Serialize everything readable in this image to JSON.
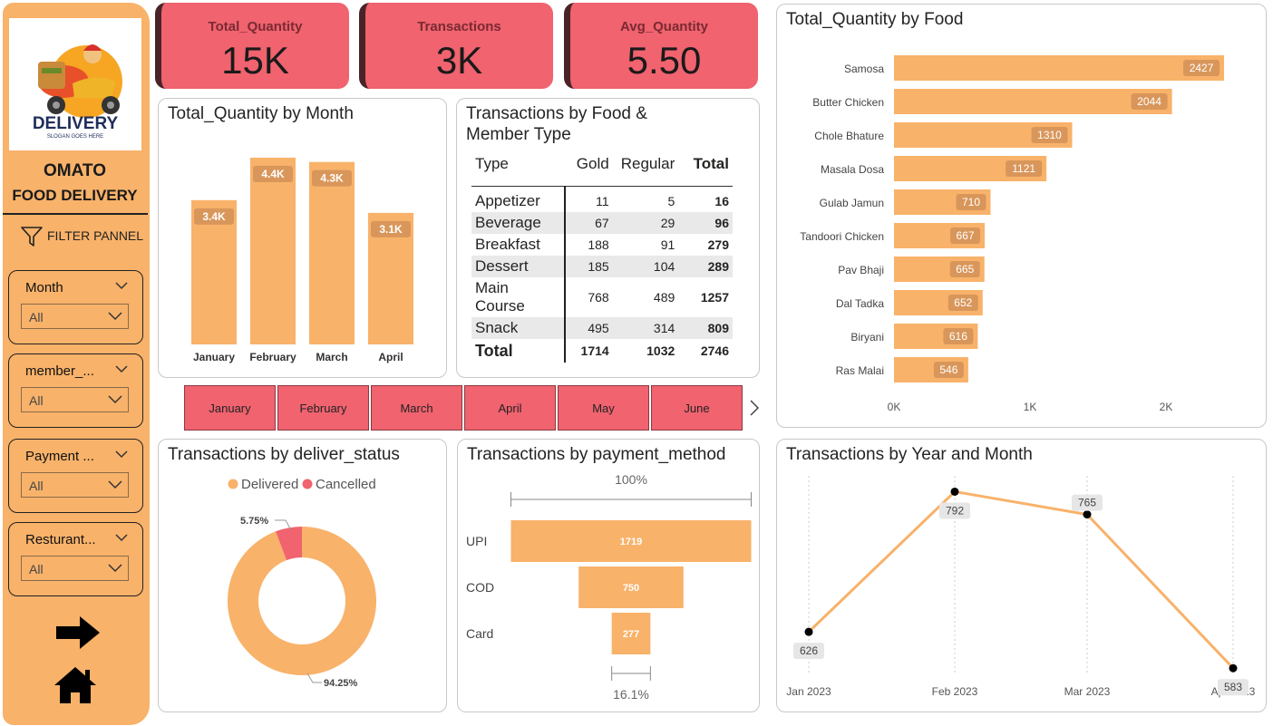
{
  "sidebar": {
    "logo_text": "DELIVERY",
    "logo_slogan": "SLOGAN GOES HERE",
    "brand_line1": "OMATO",
    "brand_line2": "FOOD DELIVERY",
    "filter_title": "FILTER PANNEL",
    "slicers": [
      {
        "label": "Month",
        "value": "All"
      },
      {
        "label": "member_...",
        "value": "All"
      },
      {
        "label": "Payment ...",
        "value": "All"
      },
      {
        "label": "Resturant...",
        "value": "All"
      }
    ]
  },
  "kpis": [
    {
      "title": "Total_Quantity",
      "value": "15K"
    },
    {
      "title": "Transactions",
      "value": "3K"
    },
    {
      "title": "Avg_Quantity",
      "value": "5.50"
    }
  ],
  "month_chart": {
    "title": "Total_Quantity by Month",
    "chart_data": {
      "type": "bar",
      "categories": [
        "January",
        "February",
        "March",
        "April"
      ],
      "values": [
        3400,
        4400,
        4300,
        3100
      ],
      "labels": [
        "3.4K",
        "4.4K",
        "4.3K",
        "3.1K"
      ]
    }
  },
  "matrix": {
    "title_line1": "Transactions by Food &",
    "title_line2": "Member Type",
    "headers": [
      "Type",
      "Gold",
      "Regular",
      "Total"
    ],
    "rows": [
      [
        "Appetizer",
        "11",
        "5",
        "16"
      ],
      [
        "Beverage",
        "67",
        "29",
        "96"
      ],
      [
        "Breakfast",
        "188",
        "91",
        "279"
      ],
      [
        "Dessert",
        "185",
        "104",
        "289"
      ],
      [
        "Main Course",
        "768",
        "489",
        "1257"
      ],
      [
        "Snack",
        "495",
        "314",
        "809"
      ]
    ],
    "total_row": [
      "Total",
      "1714",
      "1032",
      "2746"
    ]
  },
  "month_slicer": {
    "months": [
      "January",
      "February",
      "March",
      "April",
      "May",
      "June"
    ]
  },
  "food_chart": {
    "title": "Total_Quantity by Food",
    "chart_data": {
      "type": "bar",
      "categories": [
        "Samosa",
        "Butter Chicken",
        "Chole Bhature",
        "Masala Dosa",
        "Gulab Jamun",
        "Tandoori Chicken",
        "Pav Bhaji",
        "Dal Tadka",
        "Biryani",
        "Ras Malai"
      ],
      "values": [
        2427,
        2044,
        1310,
        1121,
        710,
        667,
        665,
        652,
        616,
        546
      ],
      "x_ticks": [
        "0K",
        "1K",
        "2K"
      ],
      "xlim": [
        0,
        2700
      ]
    }
  },
  "donut": {
    "title": "Transactions by deliver_status",
    "chart_data": {
      "type": "pie",
      "labels": [
        "Delivered",
        "Cancelled"
      ],
      "values": [
        94.25,
        5.75
      ],
      "value_labels": [
        "94.25%",
        "5.75%"
      ]
    }
  },
  "funnel": {
    "title": "Transactions by payment_method",
    "top_pct": "100%",
    "bottom_pct": "16.1%",
    "chart_data": {
      "type": "bar",
      "categories": [
        "UPI",
        "COD",
        "Card"
      ],
      "values": [
        1719,
        750,
        277
      ]
    }
  },
  "line": {
    "title": "Transactions by Year and Month",
    "chart_data": {
      "type": "line",
      "x": [
        "Jan 2023",
        "Feb 2023",
        "Mar 2023",
        "Apr 2023"
      ],
      "values": [
        626,
        792,
        765,
        583
      ],
      "ylim": [
        580,
        800
      ]
    }
  },
  "colors": {
    "orange": "#f8b26a",
    "red": "#f0636f",
    "dark": "#252423"
  }
}
